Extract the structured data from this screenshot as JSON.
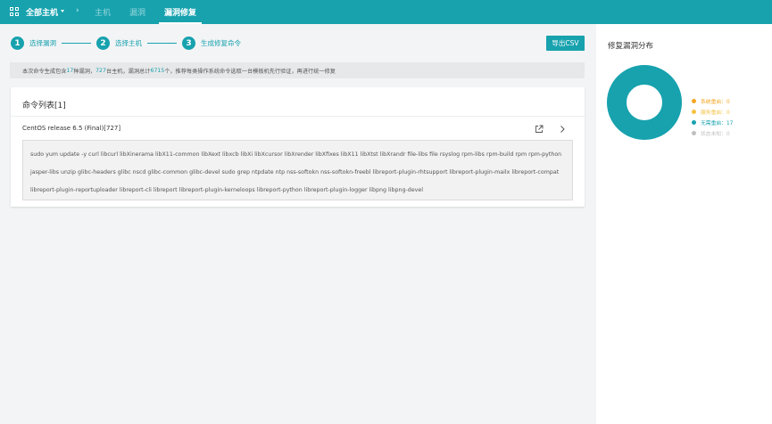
{
  "header": {
    "brand": "全部主机",
    "separator": "›",
    "tabs": [
      {
        "label": "主机"
      },
      {
        "label": "漏洞"
      },
      {
        "label": "漏洞修复"
      }
    ]
  },
  "steps": [
    {
      "num": "1",
      "label": "选择漏洞"
    },
    {
      "num": "2",
      "label": "选择主机"
    },
    {
      "num": "3",
      "label": "生成修复命令"
    }
  ],
  "export_button": "导出CSV",
  "notice": {
    "p1": "本次命令生成包含",
    "vulns": "17",
    "p2": "种漏洞，",
    "hosts": "727",
    "p3": "台主机，漏洞总计",
    "total": "6715",
    "p4": "个，推荐每类操作系统命令选取一台模板机先行验证，再进行统一修复"
  },
  "command_list": {
    "title": "命令列表[1]",
    "os_title": "CentOS release 6.5 (Final)[727]",
    "command": "sudo yum update -y curl libcurl libXinerama libX11-common libXext libxcb libXi libXcursor libXrender libXfixes libX11 libXtst libXrandr file-libs file rsyslog rpm-libs rpm-build rpm rpm-python jasper-libs unzip glibc-headers glibc nscd glibc-common glibc-devel sudo grep ntpdate ntp nss-softokn nss-softokn-freebl libreport-plugin-rhtsupport libreport-plugin-mailx libreport-compat libreport-plugin-reportuploader libreport-cli libreport libreport-plugin-kerneloops libreport-python libreport-plugin-logger libpng libpng-devel"
  },
  "distribution": {
    "title": "修复漏洞分布",
    "legend": [
      {
        "label": "系统重启：0",
        "color": "#f5a623",
        "value": 0
      },
      {
        "label": "服务重启：0",
        "color": "#f5c242",
        "value": 0
      },
      {
        "label": "无需重启：17",
        "color": "#17a2ae",
        "value": 17
      },
      {
        "label": "状态未知：0",
        "color": "#bfbfbf",
        "value": 0
      }
    ]
  },
  "colors": {
    "accent": "#17a2ae"
  }
}
